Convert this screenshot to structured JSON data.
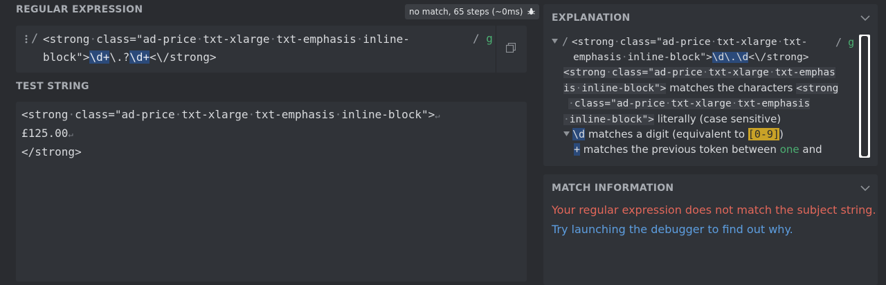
{
  "regex_section": {
    "title": "REGULAR EXPRESSION",
    "status": "no match, 65 steps (~0ms)",
    "delimiter_open": "/",
    "line1_prefix": "<strong·class=\"ad-price·txt-xlarge·txt-emphasis·inline-",
    "line2_prefix": "block\">",
    "line2_tok1": "\\d+",
    "line2_tok2": "\\.?",
    "line2_tok3": "\\d+",
    "line2_suffix": "<\\/strong>",
    "delimiter_close": "/",
    "flag": "g"
  },
  "test_section": {
    "title": "TEST STRING",
    "line1": "<strong·class=\"ad-price·txt-xlarge·txt-emphasis·inline-block\">",
    "line2": "£125.00",
    "line3": "</strong>",
    "newline_marker": "↵"
  },
  "explanation": {
    "title": "EXPLANATION",
    "row1_delim": "/",
    "row1_a": "<strong·class=\"ad-price·txt-xlarge·txt-",
    "row1_flags_sl": "/",
    "row1_flags_g": "g",
    "row2_a": "emphasis·inline-block\">",
    "row2_tok": "\\d\\.\\d",
    "row2_b": "<\\/strong>",
    "row3_code": "<strong·class=\"ad-price·txt-xlarge·txt-emphas",
    "row4_code": "is·inline-block\">",
    "row4_text": " matches the characters ",
    "row4_code2": "<strong",
    "row5_code": "·class=\"ad-price·txt-xlarge·txt-emphasis",
    "row6_code": "·inline-block\">",
    "row6_text": " literally (case sensitive)",
    "row7_tok": "\\d",
    "row7_text": " matches a digit (equivalent to ",
    "row7_cls": "[0-9]",
    "row7_end": ")",
    "row8_tok": "+",
    "row8_text": " matches the previous token between ",
    "row8_one": "one",
    "row8_and": " and"
  },
  "match_info": {
    "title": "MATCH INFORMATION",
    "error": "Your regular expression does not match the subject string.",
    "hint": "Try launching the debugger to find out why."
  },
  "colors": {
    "background": "#2a2c30",
    "panel": "#303338",
    "token_highlight": "#2b4a7a",
    "error": "#e2675a",
    "link": "#5d9ee0",
    "flag_green": "#4caf72"
  },
  "icons": [
    "drag-handle-icon",
    "copy-icon",
    "bug-icon",
    "chevron-down-icon",
    "tree-collapse-icon"
  ]
}
